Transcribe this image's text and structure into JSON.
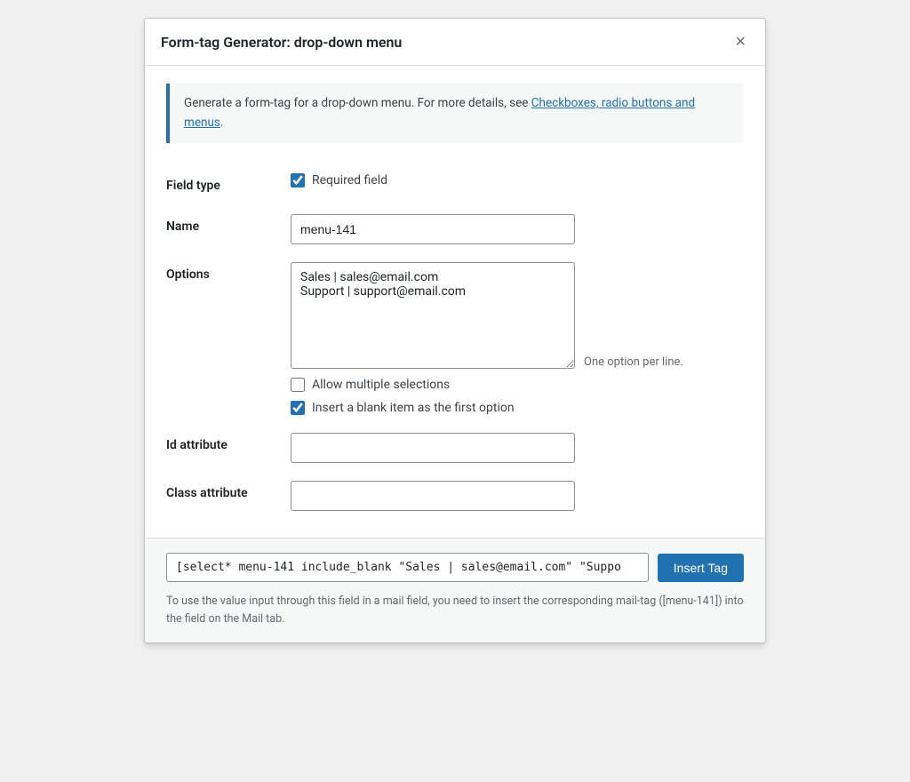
{
  "modal": {
    "title": "Form-tag Generator: drop-down menu",
    "close_label": "×"
  },
  "info": {
    "text": "Generate a form-tag for a drop-down menu. For more details, see ",
    "link_text": "Checkboxes, radio buttons and menus",
    "text_end": "."
  },
  "fields": {
    "field_type_label": "Field type",
    "required_field_label": "Required field",
    "required_field_checked": true,
    "name_label": "Name",
    "name_value": "menu-141",
    "name_placeholder": "",
    "options_label": "Options",
    "options_value": "Sales | sales@email.com\nSupport | support@email.com",
    "options_hint": "One option per line.",
    "allow_multiple_label": "Allow multiple selections",
    "allow_multiple_checked": false,
    "insert_blank_label": "Insert a blank item as the first option",
    "insert_blank_checked": true,
    "id_attribute_label": "Id attribute",
    "id_attribute_value": "",
    "id_attribute_placeholder": "",
    "class_attribute_label": "Class attribute",
    "class_attribute_value": "",
    "class_attribute_placeholder": ""
  },
  "footer": {
    "tag_value": "[select* menu-141 include_blank \"Sales | sales@email.com\" \"Suppo",
    "insert_tag_label": "Insert Tag",
    "note": "To use the value input through this field in a mail field, you need to insert the corresponding mail-tag ([menu-141]) into the field on the Mail tab."
  }
}
